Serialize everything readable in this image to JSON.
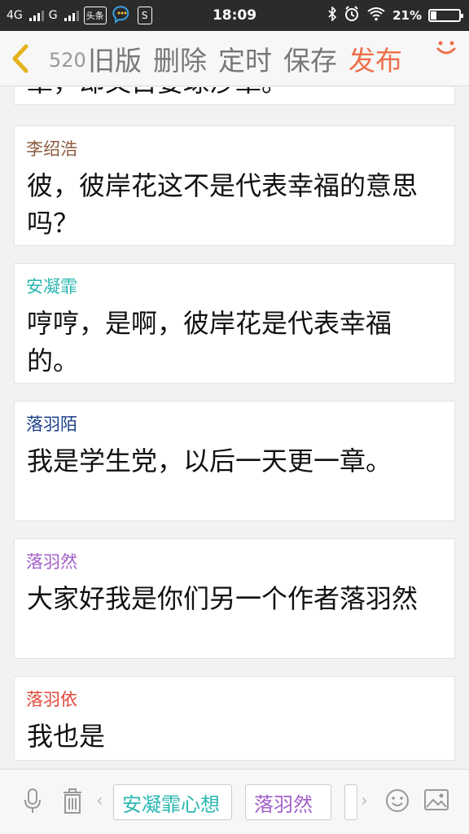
{
  "status_bar": {
    "network1": "4G",
    "network2": "G",
    "app_badge_1": "头条",
    "app_badge_3": "S",
    "time": "18:09",
    "battery_percent": "21%",
    "battery_level": 0.21
  },
  "top_bar": {
    "back_count": "520日",
    "actions": [
      "旧版",
      "删除",
      "定时",
      "保存"
    ],
    "publish": "发布"
  },
  "cards": [
    {
      "name": "",
      "text": "章，却又目要球沙章。",
      "name_color": "#8b5a2b"
    },
    {
      "name": "李绍浩",
      "text": "彼，彼岸花这不是代表幸福的意思吗？",
      "name_color": "#8b5a3c"
    },
    {
      "name": "安凝霏",
      "text": "哼哼，是啊，彼岸花是代表幸福的。",
      "name_color": "#2ab7b0"
    },
    {
      "name": "落羽陌",
      "text": "我是学生党，以后一天更一章。",
      "name_color": "#1c3f8a"
    },
    {
      "name": "落羽然",
      "text": "大家好我是你们另一个作者落羽然",
      "name_color": "#a25fc9"
    },
    {
      "name": "落羽依",
      "text": "我也是",
      "name_color": "#e0473a"
    }
  ],
  "bottom_bar": {
    "chips": [
      {
        "label": "安凝霏心想",
        "color": "#2ab7b0"
      },
      {
        "label": "落羽然",
        "color": "#a25fc9"
      }
    ]
  }
}
